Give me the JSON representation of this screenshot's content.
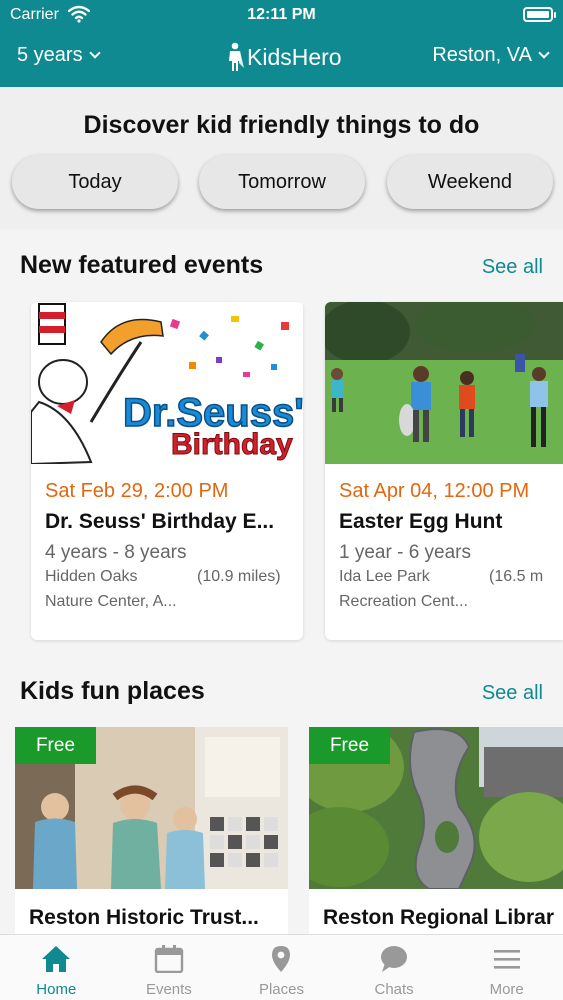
{
  "status_bar": {
    "carrier": "Carrier",
    "time": "12:11 PM"
  },
  "header": {
    "age_filter": "5 years",
    "logo_text": "KidsHero",
    "location": "Reston, VA"
  },
  "discover": {
    "title": "Discover kid friendly things to do",
    "pills": [
      "Today",
      "Tomorrow",
      "Weekend"
    ]
  },
  "featured": {
    "title": "New featured events",
    "see_all": "See all",
    "events": [
      {
        "date": "Sat Feb 29, 2:00 PM",
        "title": "Dr. Seuss' Birthday E...",
        "age_from": "4 years",
        "age_to": "8 years",
        "place_line1": "Hidden Oaks",
        "distance": "(10.9 miles)",
        "place_line2": "Nature Center, A...",
        "image_text_1": "Dr.Seuss'",
        "image_text_2": "Birthday"
      },
      {
        "date": "Sat Apr 04, 12:00 PM",
        "title": "Easter Egg Hunt",
        "age_from": "1 year",
        "age_to": "6 years",
        "place_line1": "Ida Lee Park",
        "distance": "(16.5 m",
        "place_line2": "Recreation Cent..."
      }
    ]
  },
  "places": {
    "title": "Kids fun places",
    "see_all": "See all",
    "items": [
      {
        "badge": "Free",
        "title": "Reston Historic Trust..."
      },
      {
        "badge": "Free",
        "title": "Reston Regional Librar"
      }
    ]
  },
  "tabs": [
    {
      "label": "Home",
      "icon": "home-icon",
      "active": true
    },
    {
      "label": "Events",
      "icon": "calendar-icon",
      "active": false
    },
    {
      "label": "Places",
      "icon": "map-pin-icon",
      "active": false
    },
    {
      "label": "Chats",
      "icon": "chat-bubble-icon",
      "active": false
    },
    {
      "label": "More",
      "icon": "menu-icon",
      "active": false
    }
  ],
  "colors": {
    "brand": "#0e8a90",
    "date": "#e2670f",
    "free_badge": "#1a9a2b"
  }
}
